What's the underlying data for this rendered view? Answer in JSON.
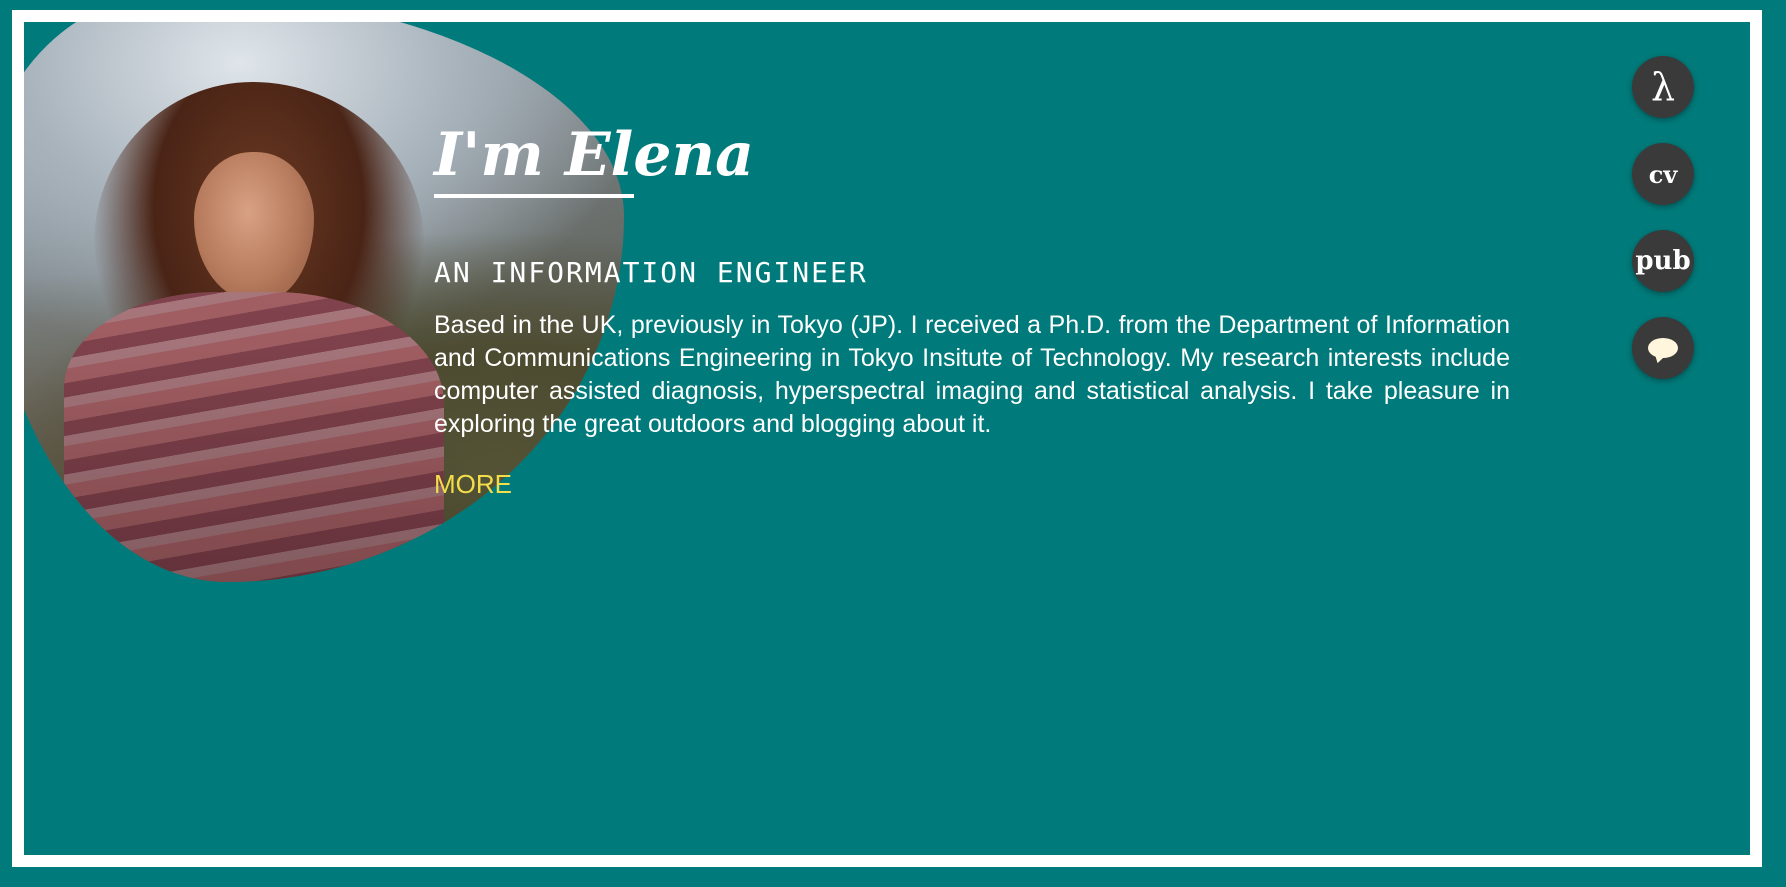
{
  "hero": {
    "title": "I'm Elena",
    "subtitle": "AN INFORMATION ENGINEER",
    "bio": "Based in the UK, previously in Tokyo (JP). I received a Ph.D. from the Department of Information and Communications Engineering in Tokyo Insitute of Technology. My research interests include computer assisted diagnosis, hyperspectral imaging and statistical analysis. I take pleasure in exploring the great outdoors and blogging about it.",
    "more_label": "MORE"
  },
  "nav": {
    "items": [
      {
        "label": "λ",
        "icon": "lambda-icon"
      },
      {
        "label": "cv",
        "icon": "cv-icon"
      },
      {
        "label": "pub",
        "icon": "pub-icon"
      },
      {
        "label": "",
        "icon": "speech-bubble-icon"
      }
    ]
  },
  "colors": {
    "background": "#007a7a",
    "frame": "#ffffff",
    "accent": "#f2dd4a",
    "nav_button": "#3a3a3a"
  }
}
